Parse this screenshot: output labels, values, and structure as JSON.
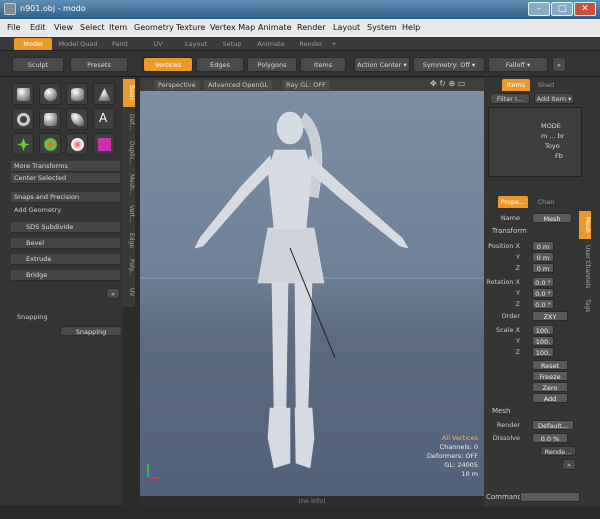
{
  "window": {
    "title": "n901.obj - modo"
  },
  "menu": [
    "File",
    "Edit",
    "View",
    "Select",
    "Item",
    "Geometry",
    "Texture",
    "Vertex Map",
    "Animate",
    "Render",
    "Layout",
    "System",
    "Help"
  ],
  "layout_tabs": [
    "Model",
    "Model Quad",
    "Paint",
    "UV",
    "Layout",
    "Setup",
    "Animate",
    "Render",
    "+"
  ],
  "toolbar": {
    "sculpt": "Sculpt",
    "presets": "Presets",
    "vertices": "Vertices",
    "edges": "Edges",
    "polygons": "Polygons",
    "items": "Items",
    "action_center": "Action Center ▾",
    "symmetry": "Symmetry: Off ▾",
    "falloff": "Falloff ▾",
    "expand": "»"
  },
  "left": {
    "more_transforms": "More Transforms",
    "center_selected": "Center Selected",
    "snaps_precision": "Snaps and Precision",
    "add_geometry": "Add Geometry",
    "sds": "SDS Subdivide",
    "bevel": "Bevel",
    "extrude": "Extrude",
    "bridge": "Bridge",
    "expand": "»",
    "snapping_hdr": "Snapping",
    "snapping_btn": "Snapping",
    "vtabs": [
      "Basic",
      "Def...",
      "Duplic...",
      "Mesh...",
      "Vert...",
      "Edge",
      "Poly...",
      "UV"
    ]
  },
  "viewport": {
    "perspective": "Perspective",
    "gl": "Advanced OpenGL",
    "ray": "Ray GL: OFF",
    "info": {
      "all_vertices": "All Vertices",
      "channels": "Channels: 0",
      "deformers": "Deformers: OFF",
      "gl_count": "GL: 24005",
      "distance": "10 m"
    },
    "status": "(no info)"
  },
  "right": {
    "tabs_top": [
      "Items",
      "Shad"
    ],
    "filter": "Filter I...",
    "add_item": "Add Item ▾",
    "tree": [
      "MODE",
      "m ... br",
      "Toyo",
      "Fb"
    ],
    "tabs_mid": [
      "Prope...",
      "Chan"
    ],
    "name_label": "Name",
    "name_val": "Mesh",
    "transform": "Transform",
    "pos": {
      "label": "Position X",
      "y": "Y",
      "z": "Z",
      "x_val": "0 m",
      "y_val": "0 m",
      "z_val": "0 m"
    },
    "rot": {
      "label": "Rotation X",
      "y": "Y",
      "z": "Z",
      "x_val": "0.0 °",
      "y_val": "0.0 °",
      "z_val": "0.0 °"
    },
    "order_label": "Order",
    "order_val": "ZXY",
    "scale": {
      "label": "Scale X",
      "y": "Y",
      "z": "Z",
      "x_val": "100.",
      "y_val": "100.",
      "z_val": "100."
    },
    "reset": "Reset",
    "freeze": "Freeze",
    "zero": "Zero",
    "add": "Add",
    "mesh_hdr": "Mesh",
    "render_label": "Render",
    "render_val": "Default...",
    "dissolve_label": "Dissolve",
    "dissolve_val": "0.0 %",
    "render_btn": "Rende...",
    "expand": "»",
    "vtabs": [
      "Mesh",
      "User Channels",
      "Tags"
    ],
    "command": "Command"
  },
  "accent": "#ea9a2a"
}
